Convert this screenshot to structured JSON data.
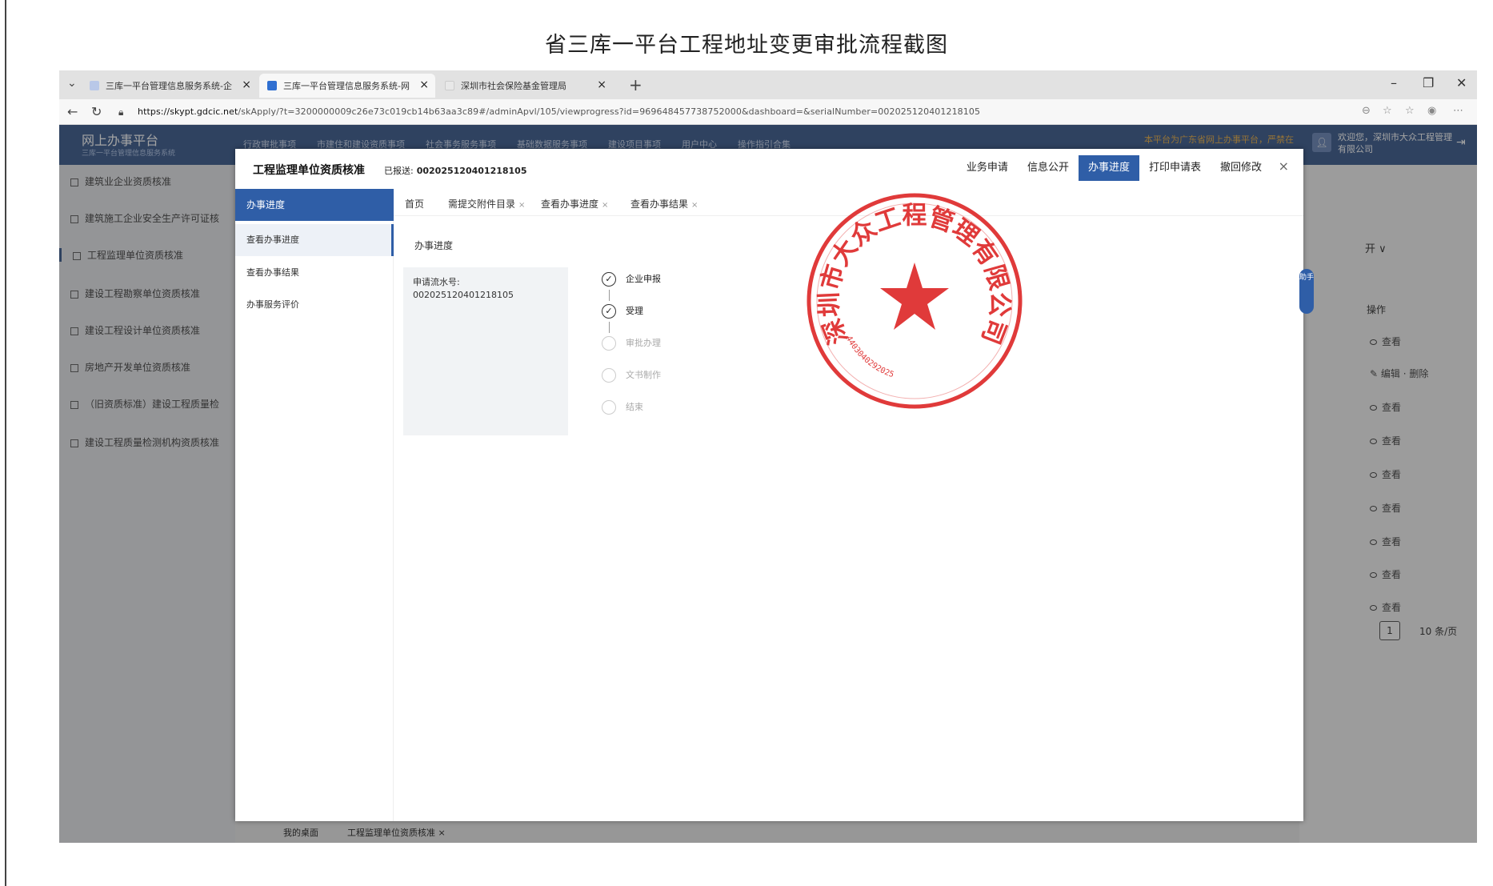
{
  "doc": {
    "title": "省三库一平台工程地址变更审批流程截图"
  },
  "browser": {
    "tabs": [
      {
        "label": "三库一平台管理信息服务系统-企",
        "close": "×"
      },
      {
        "label": "三库一平台管理信息服务系统-网",
        "close": "×"
      },
      {
        "label": "深圳市社会保险基金管理局",
        "close": "×"
      }
    ],
    "url_host": "https://skypt.gdcic.net",
    "url_path": "/skApply/?t=3200000009c26e73c019cb14b63aa3c89#/adminApvl/105/viewprogress?id=969648457738752000&dashboard=&serialNumber=002025120401218105"
  },
  "header": {
    "logo_main": "网上办事平台",
    "logo_sub": "三库一平台管理信息服务系统",
    "nav": [
      "行政审批事项",
      "市建住和建设资质事项",
      "社会事务服务事项",
      "基础数据服务事项",
      "建设项目事项",
      "用户中心",
      "操作指引合集"
    ],
    "notice": "本平台为广东省网上办事平台，严禁在",
    "user": "欢迎您，深圳市大众工程管理有限公司"
  },
  "sidebar": {
    "items": [
      "建筑业企业资质核准",
      "建筑施工企业安全生产许可证核",
      "工程监理单位资质核准",
      "建设工程勘察单位资质核准",
      "建设工程设计单位资质核准",
      "房地产开发单位资质核准",
      "（旧资质标准）建设工程质量检",
      "建设工程质量检测机构资质核准"
    ]
  },
  "background": {
    "expand": "开 ∨",
    "op_title": "操作",
    "op_links": [
      "查看",
      "编辑 · 删除",
      "查看",
      "查看",
      "查看",
      "查看",
      "查看",
      "查看",
      "查看"
    ],
    "pager_num": "1",
    "pager_size": "10 条/页",
    "bottom_tabs": [
      "我的桌面",
      "工程监理单位资质核准 ×"
    ]
  },
  "modal": {
    "title": "工程监理单位资质核准",
    "status_label": "已报送:",
    "status_num": "002025120401218105",
    "actions": [
      "业务申请",
      "信息公开",
      "办事进度",
      "打印申请表",
      "撤回修改"
    ],
    "side_head": "办事进度",
    "side_items": [
      "查看办事进度",
      "查看办事结果",
      "办事服务评价"
    ],
    "tabs": [
      "首页",
      "需提交附件目录",
      "查看办事进度",
      "查看办事结果"
    ],
    "section": "办事进度",
    "serial_label": "申请流水号:",
    "serial_value": "002025120401218105",
    "steps": [
      {
        "label": "企业申报",
        "done": true
      },
      {
        "label": "受理",
        "done": true
      },
      {
        "label": "审批办理",
        "done": false
      },
      {
        "label": "文书制作",
        "done": false
      },
      {
        "label": "结束",
        "done": false
      }
    ],
    "helper": "助手"
  },
  "seal": {
    "text": "深圳市大众工程管理有限公司",
    "code": "4403040292025",
    "color": "#e03a3a"
  }
}
